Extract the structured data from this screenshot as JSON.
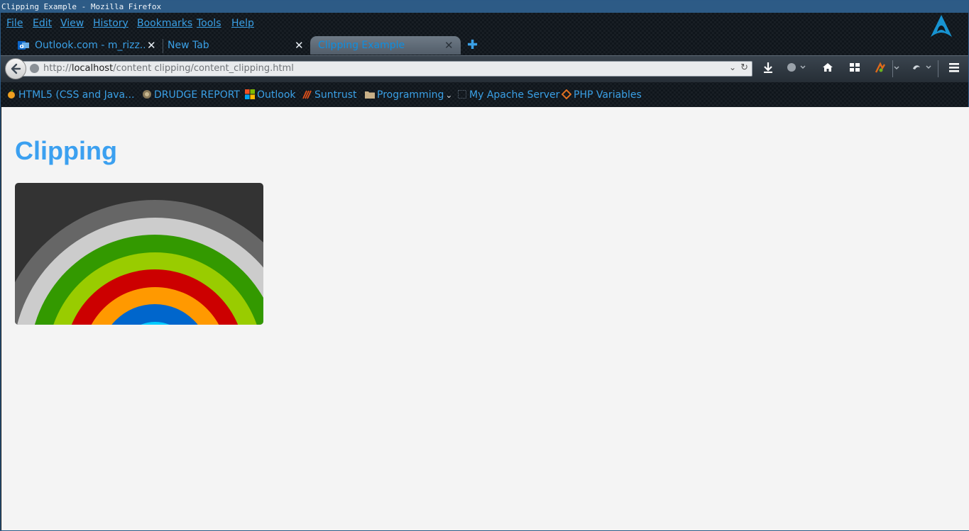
{
  "window": {
    "title": "Clipping Example - Mozilla Firefox"
  },
  "menu": [
    "File",
    "Edit",
    "View",
    "History",
    "Bookmarks",
    "Tools",
    "Help"
  ],
  "tabs": [
    {
      "label": "Outlook.com - m_rizz...",
      "icon": "outlook-icon",
      "active": false
    },
    {
      "label": "New Tab",
      "active": false
    },
    {
      "label": "Clipping Example",
      "active": true
    }
  ],
  "url": {
    "scheme": "http://",
    "host": "localhost",
    "path": "/content clipping/content_clipping.html"
  },
  "bookmarks": [
    {
      "label": "HTML5 (CSS and Java...",
      "icon": "fruit-icon"
    },
    {
      "label": "DRUDGE REPORT",
      "icon": "drudge-icon"
    },
    {
      "label": "Outlook",
      "icon": "windows-logo-icon"
    },
    {
      "label": "Suntrust",
      "icon": "suntrust-icon"
    },
    {
      "label": "Programming",
      "icon": "folder-icon"
    },
    {
      "label": "My Apache Server",
      "icon": "page-icon"
    },
    {
      "label": "PHP Variables",
      "icon": "code-icon"
    }
  ],
  "page": {
    "heading": "Clipping",
    "rings": {
      "background": "#333333",
      "colors": [
        "#666666",
        "#cccccc",
        "#339900",
        "#99cc00",
        "#cc0000",
        "#ff9900",
        "#0066cc",
        "#00ccff"
      ]
    }
  },
  "colors": {
    "accent": "#3ba0f0",
    "link": "#3aa0e6",
    "titlebar": "#2d5b86"
  }
}
